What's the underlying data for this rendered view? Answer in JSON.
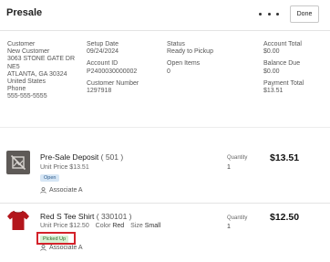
{
  "header": {
    "title": "Presale",
    "more_icon": "more-horizontal-icon",
    "done_label": "Done"
  },
  "info": {
    "customer": {
      "label": "Customer",
      "name": "New Customer",
      "address_line1": "3063 STONE GATE DR",
      "address_line2": "NE5",
      "city_line": "ATLANTA, GA 30324",
      "country": "United States",
      "phone_label": "Phone",
      "phone": "555-555-5555"
    },
    "setup_date": {
      "label": "Setup Date",
      "value": "09/24/2024"
    },
    "account_id": {
      "label": "Account ID",
      "value": "P2400030000002"
    },
    "customer_number": {
      "label": "Customer Number",
      "value": "1297918"
    },
    "status": {
      "label": "Status",
      "value": "Ready to Pickup"
    },
    "open_items": {
      "label": "Open Items",
      "value": "0"
    },
    "account_total": {
      "label": "Account Total",
      "value": "$0.00"
    },
    "balance_due": {
      "label": "Balance Due",
      "value": "$0.00"
    },
    "payment_total": {
      "label": "Payment Total",
      "value": "$13.51"
    }
  },
  "items": [
    {
      "name": "Pre-Sale Deposit",
      "code": "( 501 )",
      "unit_price_label": "Unit Price",
      "unit_price": "$13.51",
      "badge": "Open",
      "associate": "Associate A",
      "quantity_label": "Quantity",
      "quantity": "1",
      "price": "$13.51",
      "thumb_icon": "image-unavailable-icon"
    },
    {
      "name": "Red S Tee Shirt",
      "code": "( 330101 )",
      "unit_price_label": "Unit Price",
      "unit_price": "$12.50",
      "color_label": "Color",
      "color": "Red",
      "size_label": "Size",
      "size": "Small",
      "badge": "Picked Up",
      "associate": "Associate A",
      "quantity_label": "Quantity",
      "quantity": "1",
      "price": "$12.50",
      "thumb_icon": "red-tee-shirt-icon"
    }
  ],
  "colors": {
    "open_badge_bg": "#d6e6f5",
    "picked_badge_bg": "#d8f0d4",
    "highlight_border": "#d3222a",
    "shirt": "#b3161c"
  }
}
